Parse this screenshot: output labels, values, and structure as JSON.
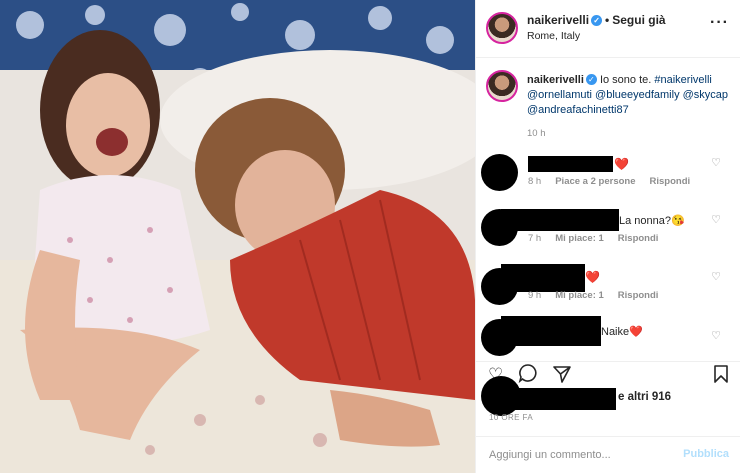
{
  "header": {
    "username": "naikerivelli",
    "separator": "•",
    "follow_label": "Segui già",
    "location": "Rome, Italy",
    "more_icon": "more-horizontal-icon"
  },
  "caption": {
    "username": "naikerivelli",
    "text": "Io sono te.",
    "hashtag": "#naikerivelli",
    "mentions": [
      "@ornellamuti",
      "@blueeyedfamily",
      "@skycap",
      "@andreafachinetti87"
    ],
    "time": "10 h"
  },
  "comments": [
    {
      "text": "❤️",
      "time": "8 h",
      "likes": "Piace a 2 persone",
      "reply": "Rispondi"
    },
    {
      "text": "La nonna?😘",
      "time": "7 h",
      "likes": "Mi piace: 1",
      "reply": "Rispondi"
    },
    {
      "text": "❤️",
      "time": "9 h",
      "likes": "Mi piace: 1",
      "reply": "Rispondi"
    },
    {
      "text": "Naike❤️"
    }
  ],
  "actions": {
    "icons": [
      "heart-icon",
      "comment-icon",
      "share-icon",
      "bookmark-icon"
    ]
  },
  "likes": {
    "text": "e altri 916"
  },
  "post_time": "10 ORE FA",
  "add_comment": {
    "placeholder": "Aggiungi un commento...",
    "publish_label": "Pubblica"
  },
  "colors": {
    "link": "#00376b",
    "verified": "#3897f0",
    "heart": "#ed4956",
    "publish_disabled": "#b2dffc",
    "muted": "#8e8e8e"
  }
}
